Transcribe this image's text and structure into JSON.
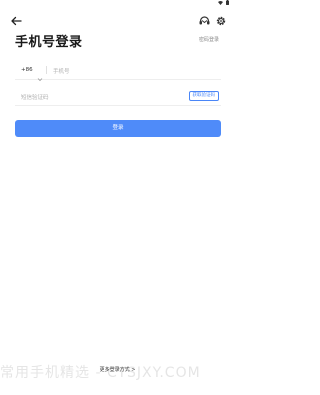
{
  "page": {
    "title": "手机号登录",
    "password_login_link": "密码登录",
    "phone_field": {
      "country_code": "+86",
      "placeholder": "手机号"
    },
    "code_field": {
      "placeholder": "短信验证码",
      "get_code_button": "获取验证码"
    },
    "login_button": "登录",
    "more_login_methods": "更多登录方式",
    "more_login_chevron": ">"
  },
  "watermark": "常用手机精选 - CYSJXY.COM",
  "icons": {
    "back": "back-arrow-icon",
    "headset": "headset-icon",
    "settings": "gear-icon",
    "wifi": "wifi-icon",
    "battery": "battery-icon",
    "dropdown": "chevron-down-icon"
  },
  "colors": {
    "accent": "#4f8bf9",
    "background": "#ffffff"
  }
}
